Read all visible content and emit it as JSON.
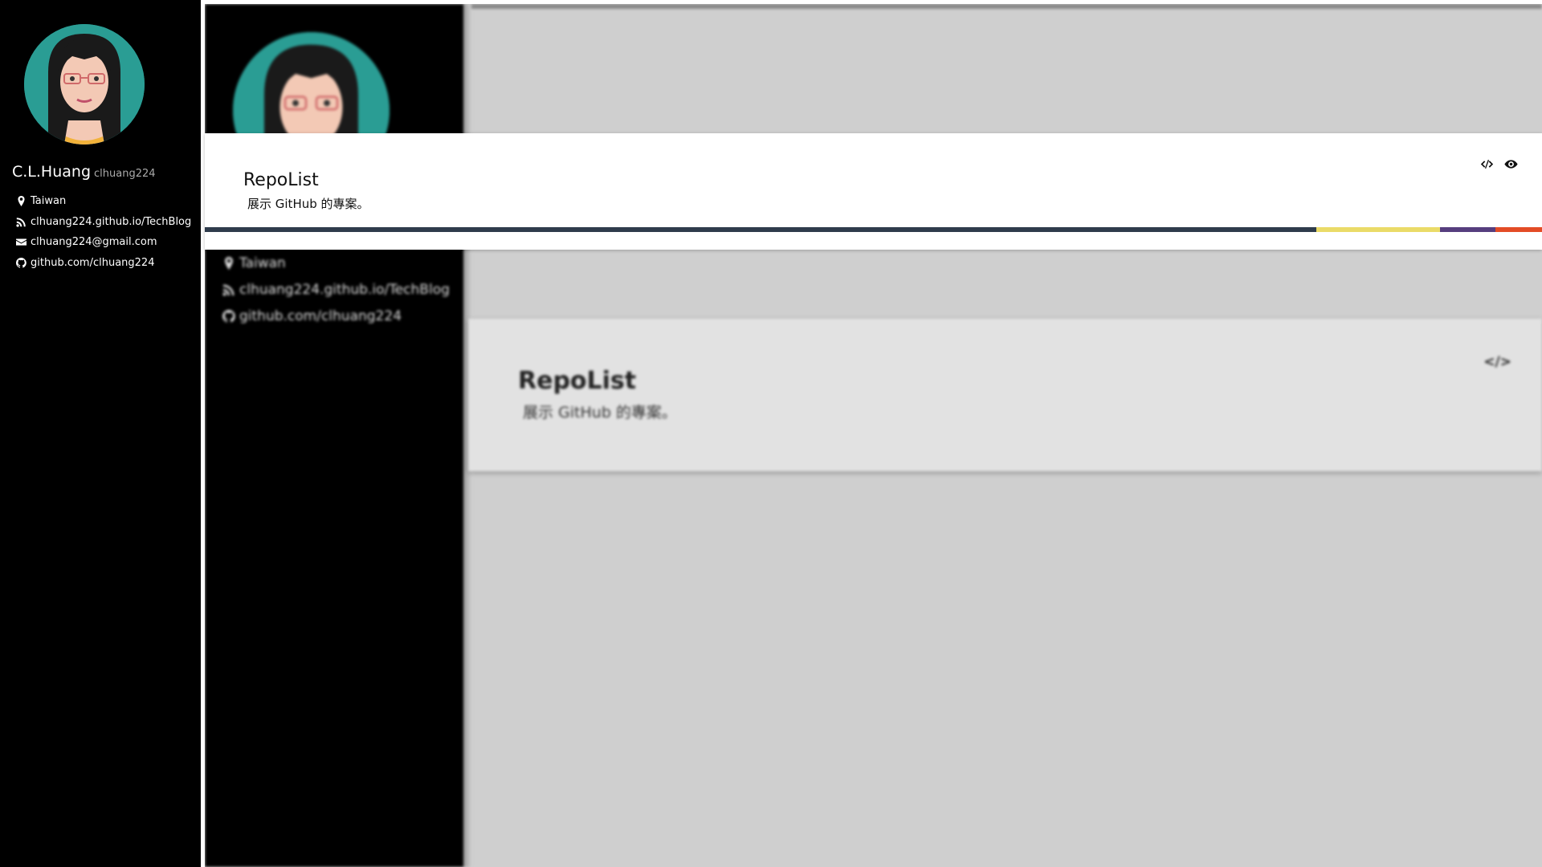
{
  "profile": {
    "name": "C.L.Huang",
    "username": "clhuang224",
    "location": "Taiwan",
    "blog": "clhuang224.github.io/TechBlog",
    "email": "clhuang224@gmail.com",
    "github": "github.com/clhuang224"
  },
  "repo_card": {
    "title": "RepoList",
    "description": "展示 GitHub 的專案。",
    "actions": [
      {
        "name": "view-code-button",
        "icon": "code-icon"
      },
      {
        "name": "view-demo-button",
        "icon": "eye-icon"
      }
    ],
    "languages": [
      {
        "color": "#2f3c4c",
        "share": 0.831
      },
      {
        "color": "#eadb68",
        "share": 0.093
      },
      {
        "color": "#563e7e",
        "share": 0.041
      },
      {
        "color": "#e34c26",
        "share": 0.035
      }
    ]
  },
  "preview": {
    "location": "Taiwan",
    "blog": "clhuang224.github.io/TechBlog",
    "github": "github.com/clhuang224",
    "card_title": "RepoList",
    "card_description": "展示 GitHub 的專案。",
    "card_action_icon": "code-icon"
  },
  "colors": {
    "sidebar_bg": "#000000",
    "avatar_bg": "#2a9d94",
    "preview_bg": "#cfcfcf"
  }
}
